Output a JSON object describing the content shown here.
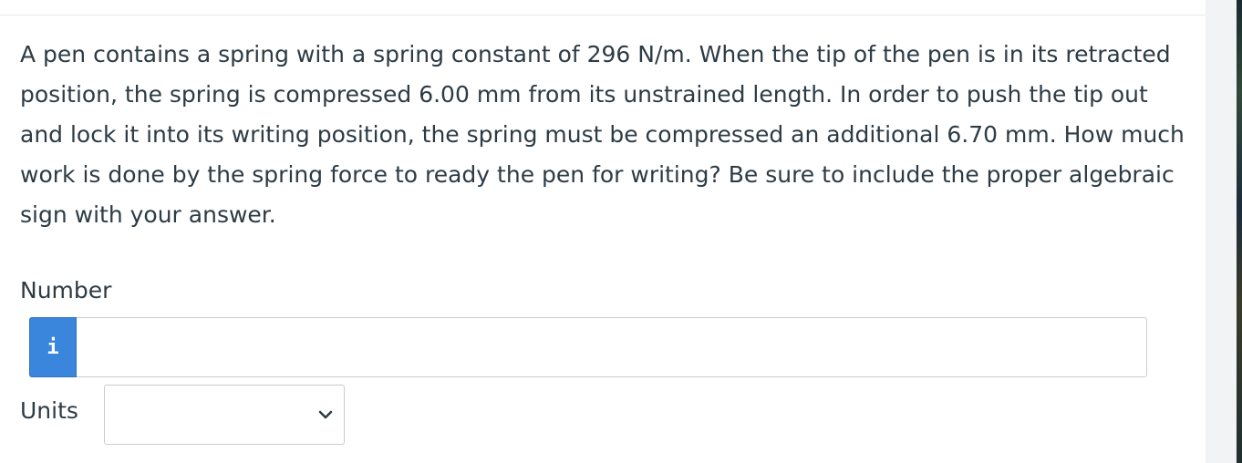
{
  "question": {
    "text": "A pen contains a spring with a spring constant of 296 N/m. When the tip of the pen is in its retracted position, the spring is compressed 6.00 mm from its unstrained length. In order to push the tip out and lock it into its writing position, the spring must be compressed an additional 6.70 mm. How much work is done by the spring force to ready the pen for writing? Be sure to include the proper algebraic sign with your answer."
  },
  "number": {
    "label": "Number",
    "info_icon": "i",
    "value": ""
  },
  "units": {
    "label": "Units",
    "selected": "",
    "icon": "chevron-down-icon"
  },
  "colors": {
    "info_button": "#3a86dc",
    "text": "#2d3b45",
    "border": "#c7cdd1"
  }
}
